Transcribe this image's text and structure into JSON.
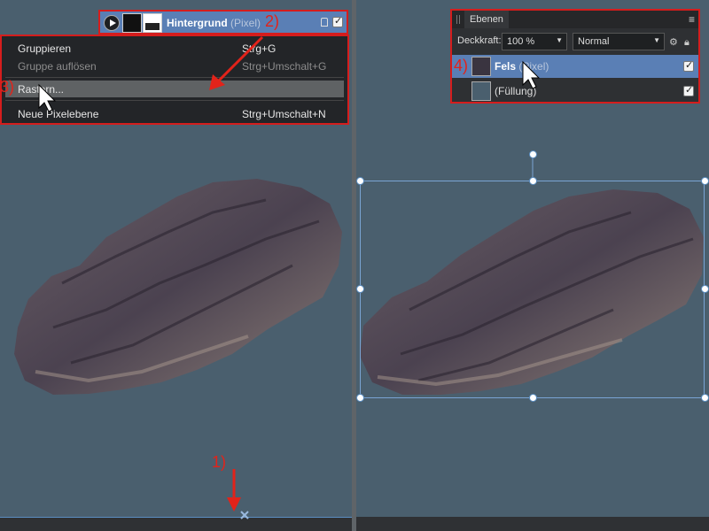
{
  "layer_row_left": {
    "name": "Hintergrund",
    "kind": "(Pixel)"
  },
  "context_menu": {
    "items": [
      {
        "label": "Gruppieren",
        "shortcut": "Strg+G",
        "state": "normal"
      },
      {
        "label": "Gruppe auflösen",
        "shortcut": "Strg+Umschalt+G",
        "state": "disabled"
      },
      {
        "label": "Rastern...",
        "shortcut": "",
        "state": "hover"
      },
      {
        "label": "Neue Pixelebene",
        "shortcut": "Strg+Umschalt+N",
        "state": "normal"
      }
    ]
  },
  "annotations": {
    "step1": "1)",
    "step2": "2)",
    "step3": "3)",
    "step4": "4)"
  },
  "layers_panel": {
    "tab": "Ebenen",
    "opacity_label": "Deckkraft:",
    "opacity_value": "100 %",
    "blend_mode": "Normal",
    "layers": [
      {
        "name": "Fels",
        "kind": "(Pixel)",
        "selected": true,
        "visible": true
      },
      {
        "name": "",
        "kind": "(Füllung)",
        "selected": false,
        "visible": true
      }
    ]
  },
  "colors": {
    "canvas": "#4a5f6e",
    "selection": "#5a7fb5",
    "annotation_red": "#d51d1d",
    "rock": "#4e4450"
  },
  "icons": [
    "play-icon",
    "lock-icon",
    "checkbox-icon",
    "gear-icon",
    "panel-menu-icon",
    "cursor-icon",
    "arrow-icon",
    "anchor-icon"
  ]
}
